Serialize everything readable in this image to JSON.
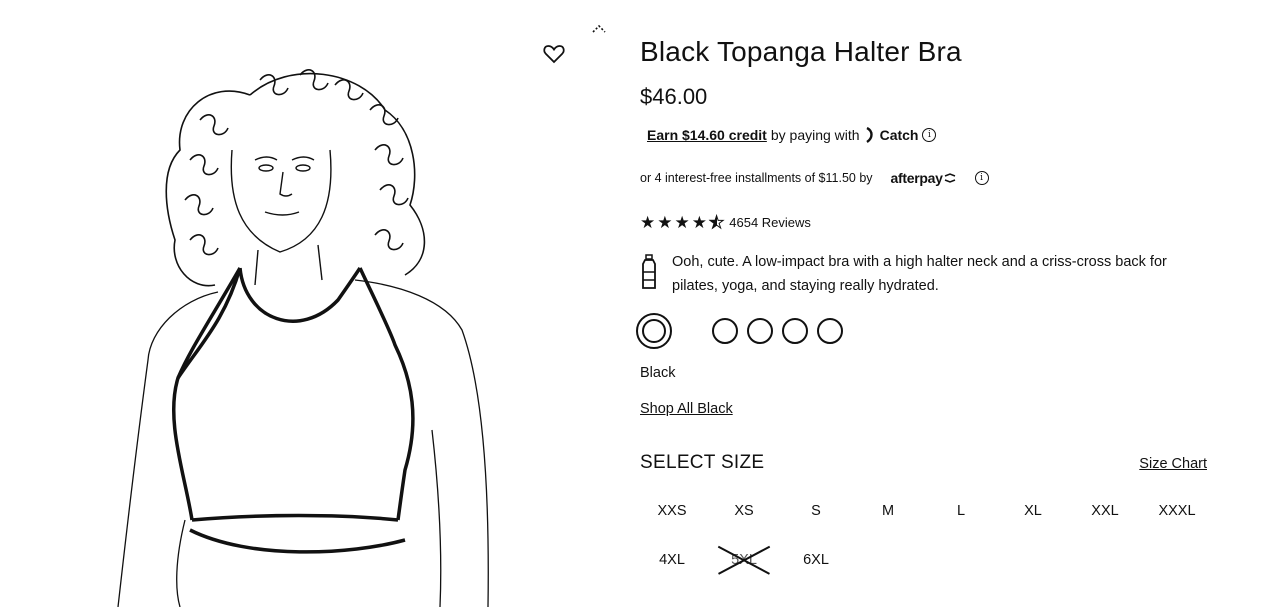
{
  "product": {
    "title": "Black Topanga Halter Bra",
    "price": "$46.00"
  },
  "catch": {
    "earn_label": "Earn $14.60 credit",
    "paying_text": "by paying with",
    "brand": "Catch",
    "icon": "info-icon"
  },
  "afterpay": {
    "text": "or 4 interest-free installments of $11.50 by",
    "brand": "afterpay",
    "icon": "info-icon"
  },
  "rating": {
    "stars": 4.5,
    "max_stars": 5,
    "count_label": "4654 Reviews"
  },
  "description": {
    "icon": "water-bottle-icon",
    "text": "Ooh, cute. A low-impact bra with a high halter neck and a criss-cross back for pilates, yoga, and staying really hydrated."
  },
  "colors": {
    "selected_name": "Black",
    "swatch_count": 5,
    "selected_index": 0
  },
  "shop_all_label": "Shop All Black",
  "size": {
    "heading": "SELECT SIZE",
    "chart_label": "Size Chart",
    "options": [
      {
        "label": "XXS",
        "available": true
      },
      {
        "label": "XS",
        "available": true
      },
      {
        "label": "S",
        "available": true
      },
      {
        "label": "M",
        "available": true
      },
      {
        "label": "L",
        "available": true
      },
      {
        "label": "XL",
        "available": true
      },
      {
        "label": "XXL",
        "available": true
      },
      {
        "label": "XXXL",
        "available": true
      },
      {
        "label": "4XL",
        "available": true
      },
      {
        "label": "5XL",
        "available": false
      },
      {
        "label": "6XL",
        "available": true
      }
    ]
  },
  "gallery": {
    "wishlist_icon": "heart-icon",
    "scroll_icon": "chevron-up-icon"
  }
}
